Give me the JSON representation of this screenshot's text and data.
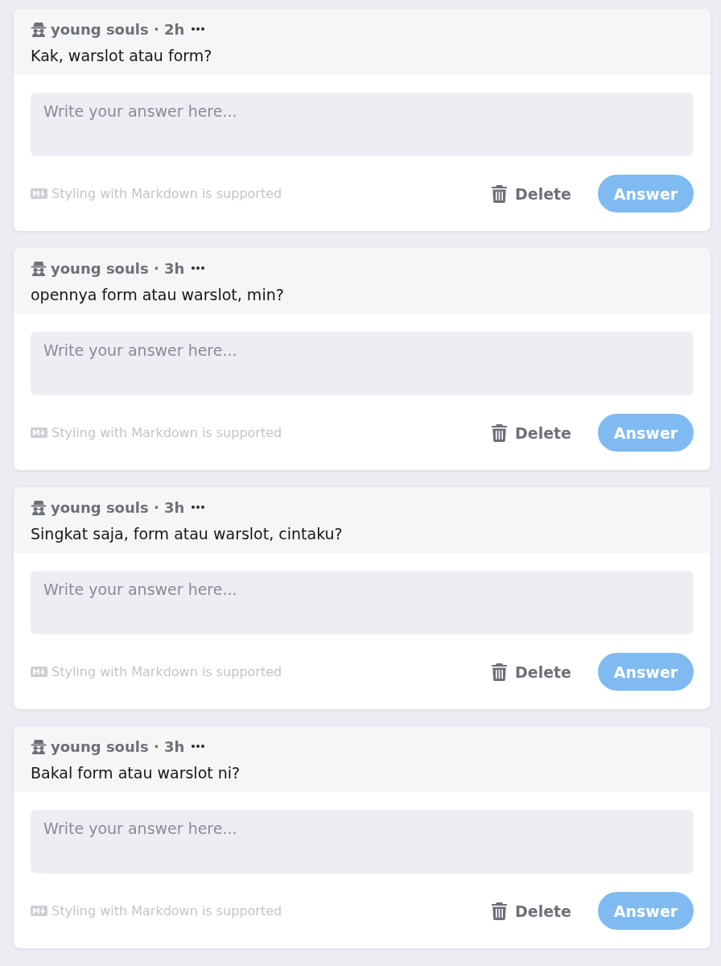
{
  "questions": [
    {
      "byline": "young souls · 2h",
      "text": "Kak, warslot atau form?",
      "answer_field": {
        "placeholder": "Write your answer here..."
      },
      "markdown_note": "Styling with Markdown is supported",
      "delete_button": "Delete",
      "answer_button": {
        "label": "Answer",
        "disabled": true
      }
    },
    {
      "byline": "young souls · 3h",
      "text": "opennya form atau warslot, min?",
      "answer_field": {
        "placeholder": "Write your answer here..."
      },
      "markdown_note": "Styling with Markdown is supported",
      "delete_button": "Delete",
      "answer_button": {
        "label": "Answer",
        "disabled": true
      }
    },
    {
      "byline": "young souls · 3h",
      "text": "Singkat saja, form atau warslot, cintaku?",
      "answer_field": {
        "placeholder": "Write your answer here..."
      },
      "markdown_note": "Styling with Markdown is supported",
      "delete_button": "Delete",
      "answer_button": {
        "label": "Answer",
        "disabled": true
      }
    },
    {
      "byline": "young souls · 3h",
      "text": "Bakal form atau warslot ni?",
      "answer_field": {
        "placeholder": "Write your answer here..."
      },
      "markdown_note": "Styling with Markdown is supported",
      "delete_button": "Delete",
      "answer_button": {
        "label": "Answer",
        "disabled": true
      }
    }
  ]
}
